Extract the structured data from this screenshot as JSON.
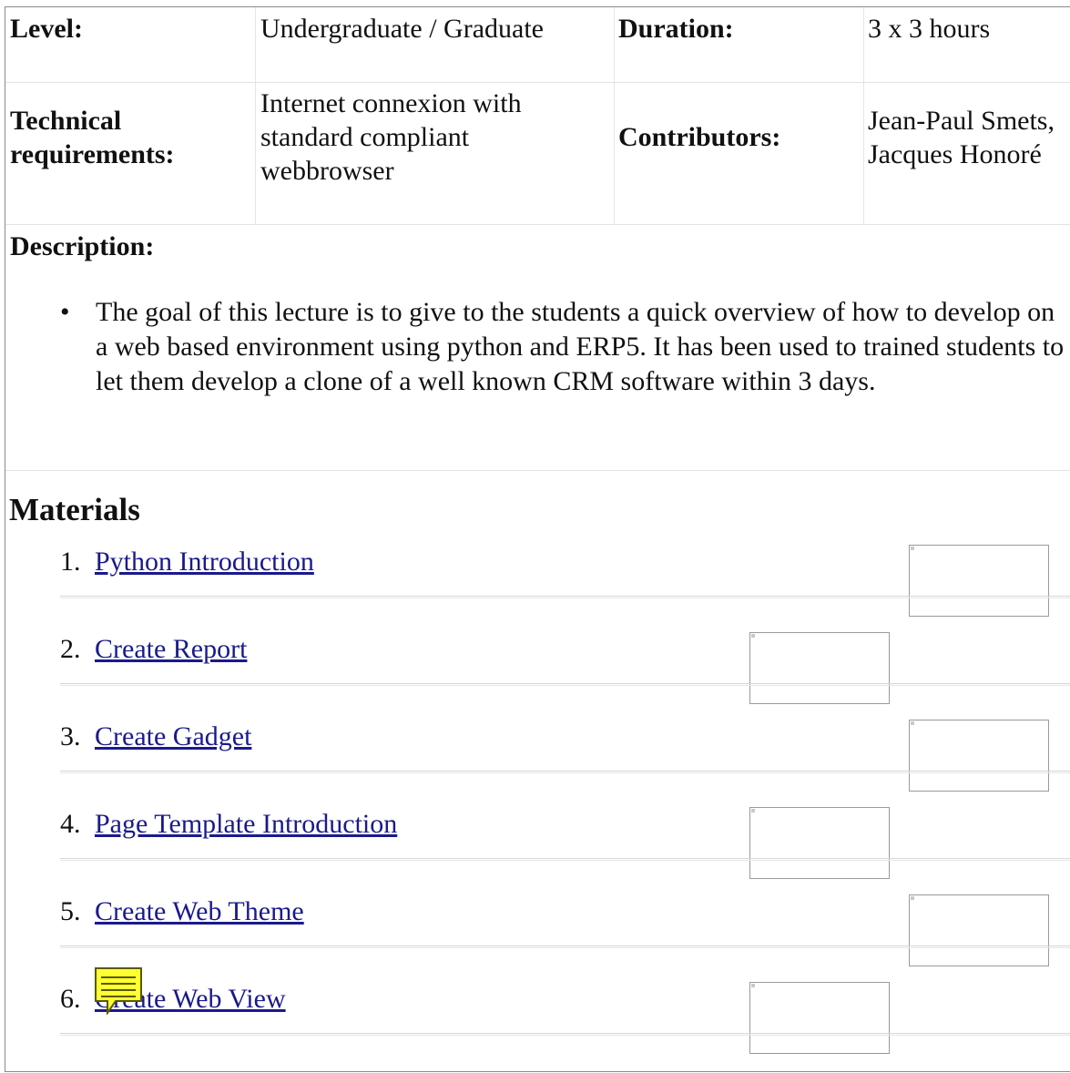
{
  "info_table": {
    "level_label": "Level:",
    "level_value": "Undergraduate / Graduate",
    "duration_label": "Duration:",
    "duration_value": "3 x 3 hours",
    "tech_label": "Technical requirements:",
    "tech_value": "Internet connexion with standard compliant webbrowser",
    "contributors_label": "Contributors:",
    "contributors_value": "Jean-Paul Smets, Jacques Honoré"
  },
  "description": {
    "label": "Description:",
    "bullet": "•",
    "text": "The goal of this lecture is to give to the students a quick overview of how to develop on a web based environment using python and ERP5. It has been used to trained students to let them develop a clone of a well known CRM software within 3 days."
  },
  "materials": {
    "heading": "Materials",
    "items": [
      {
        "num": "1.",
        "label": "Python Introduction"
      },
      {
        "num": "2.",
        "label": "Create Report"
      },
      {
        "num": "3.",
        "label": "Create Gadget"
      },
      {
        "num": "4.",
        "label": "Page Template Introduction"
      },
      {
        "num": "5.",
        "label": "Create Web Theme"
      },
      {
        "num": "6.",
        "label": "Create Web View"
      }
    ]
  },
  "colors": {
    "link": "#1a1a8c",
    "note_icon": "#ffff33"
  },
  "icons": {
    "note": "sticky-note-icon",
    "broken_image": "broken-image-icon"
  }
}
